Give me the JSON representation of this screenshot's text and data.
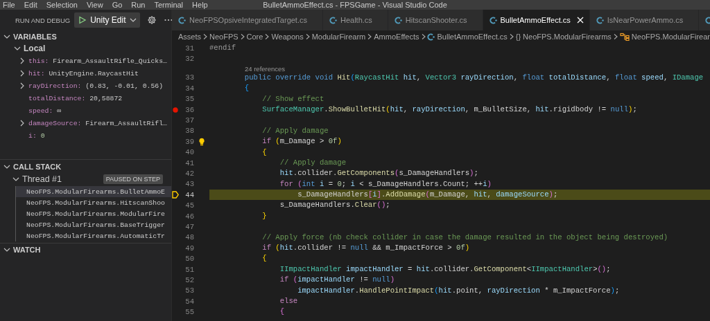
{
  "menu": [
    "File",
    "Edit",
    "Selection",
    "View",
    "Go",
    "Run",
    "Terminal",
    "Help"
  ],
  "window": {
    "title": "BulletAmmoEffect.cs - FPSGame - Visual Studio Code"
  },
  "sidebar": {
    "title": "RUN AND DEBUG",
    "configuration": "Unity Edit",
    "variables": {
      "title": "VARIABLES",
      "expanded": true,
      "scope": {
        "label": "Local",
        "expanded": true
      },
      "items": [
        {
          "name": "this:",
          "value": "Firearm_AssaultRifle_Quicks…",
          "expandable": true,
          "kind": "object"
        },
        {
          "name": "hit:",
          "value": "UnityEngine.RaycastHit",
          "expandable": true,
          "kind": "object"
        },
        {
          "name": "rayDirection:",
          "value": "(0.83, -0.01, 0.56)",
          "expandable": true,
          "kind": "object"
        },
        {
          "name": "totalDistance:",
          "value": "20,58872",
          "expandable": false,
          "kind": "value"
        },
        {
          "name": "speed:",
          "value": "∞",
          "expandable": false,
          "kind": "value"
        },
        {
          "name": "damageSource:",
          "value": "Firearm_AssaultRifl…",
          "expandable": true,
          "kind": "object"
        },
        {
          "name": "i:",
          "value": "0",
          "expandable": false,
          "kind": "number"
        }
      ]
    },
    "call_stack": {
      "title": "CALL STACK",
      "expanded": true,
      "thread": {
        "label": "Thread #1",
        "expanded": true,
        "status": "PAUSED ON STEP"
      },
      "frames": [
        {
          "label": "NeoFPS.ModularFirearms.BulletAmmoE",
          "selected": true
        },
        {
          "label": "NeoFPS.ModularFirearms.HitscanShoo",
          "selected": false
        },
        {
          "label": "NeoFPS.ModularFirearms.ModularFire",
          "selected": false
        },
        {
          "label": "NeoFPS.ModularFirearms.BaseTrigger",
          "selected": false
        },
        {
          "label": "NeoFPS.ModularFirearms.AutomaticTr",
          "selected": false
        }
      ]
    },
    "watch": {
      "title": "WATCH",
      "expanded": true
    }
  },
  "editor": {
    "tabs": [
      {
        "label": "NeoFPSOpsiveIntegratedTarget.cs",
        "selected": false
      },
      {
        "label": "Health.cs",
        "selected": false
      },
      {
        "label": "HitscanShooter.cs",
        "selected": false
      },
      {
        "label": "BulletAmmoEffect.cs",
        "selected": true
      },
      {
        "label": "IsNearPowerAmmo.cs",
        "selected": false
      }
    ],
    "breadcrumbs": [
      {
        "kind": "folder",
        "label": "Assets"
      },
      {
        "kind": "folder",
        "label": "NeoFPS"
      },
      {
        "kind": "folder",
        "label": "Core"
      },
      {
        "kind": "folder",
        "label": "Weapons"
      },
      {
        "kind": "folder",
        "label": "ModularFirearm"
      },
      {
        "kind": "folder",
        "label": "AmmoEffects"
      },
      {
        "kind": "file",
        "label": "BulletAmmoEffect.cs"
      },
      {
        "kind": "namespace",
        "symbol": "{}",
        "label": "NeoFPS.ModularFirearms"
      },
      {
        "kind": "class",
        "label": "NeoFPS.ModularFirear"
      }
    ],
    "lines": [
      {
        "number": "31",
        "breakpoint": false,
        "current": false,
        "lightbulb": false,
        "segments": [
          {
            "kind": "preprocessor",
            "text": "#endif"
          }
        ]
      },
      {
        "number": "32",
        "breakpoint": false,
        "current": false,
        "lightbulb": false
      },
      {
        "number": "33",
        "breakpoint": false,
        "current": false,
        "lightbulb": false,
        "codelens": "24 references",
        "segments": [
          {
            "kind": "keyword",
            "text": "        public override void "
          },
          {
            "kind": "method",
            "text": "Hit"
          },
          {
            "kind": "bracket3",
            "text": "("
          },
          {
            "kind": "type",
            "text": "RaycastHit "
          },
          {
            "kind": "variable",
            "text": "hit"
          },
          {
            "kind": "plain",
            "text": ", "
          },
          {
            "kind": "type",
            "text": "Vector3 "
          },
          {
            "kind": "variable",
            "text": "rayDirection"
          },
          {
            "kind": "plain",
            "text": ", "
          },
          {
            "kind": "keyword",
            "text": "float "
          },
          {
            "kind": "variable",
            "text": "totalDistance"
          },
          {
            "kind": "plain",
            "text": ", "
          },
          {
            "kind": "keyword",
            "text": "float "
          },
          {
            "kind": "variable",
            "text": "speed"
          },
          {
            "kind": "plain",
            "text": ", "
          },
          {
            "kind": "type",
            "text": "IDamage"
          }
        ]
      },
      {
        "number": "34",
        "breakpoint": false,
        "current": false,
        "lightbulb": false,
        "segments": [
          {
            "kind": "bracket3",
            "text": "        {"
          }
        ]
      },
      {
        "number": "35",
        "breakpoint": false,
        "current": false,
        "lightbulb": false,
        "segments": [
          {
            "kind": "comment",
            "text": "            // Show effect"
          }
        ]
      },
      {
        "number": "36",
        "breakpoint": true,
        "current": false,
        "lightbulb": false,
        "segments": [
          {
            "kind": "type",
            "text": "            SurfaceManager"
          },
          {
            "kind": "plain",
            "text": "."
          },
          {
            "kind": "method",
            "text": "ShowBulletHit"
          },
          {
            "kind": "bracket1",
            "text": "("
          },
          {
            "kind": "variable",
            "text": "hit"
          },
          {
            "kind": "plain",
            "text": ", "
          },
          {
            "kind": "variable",
            "text": "rayDirection"
          },
          {
            "kind": "plain",
            "text": ", m_BulletSize, "
          },
          {
            "kind": "variable",
            "text": "hit"
          },
          {
            "kind": "plain",
            "text": ".rigidbody != "
          },
          {
            "kind": "keyword",
            "text": "null"
          },
          {
            "kind": "bracket1",
            "text": ")"
          },
          {
            "kind": "plain",
            "text": ";"
          }
        ]
      },
      {
        "number": "37",
        "breakpoint": false,
        "current": false,
        "lightbulb": false
      },
      {
        "number": "38",
        "breakpoint": false,
        "current": false,
        "lightbulb": false,
        "segments": [
          {
            "kind": "comment",
            "text": "            // Apply damage"
          }
        ]
      },
      {
        "number": "39",
        "breakpoint": false,
        "current": false,
        "lightbulb": true,
        "segments": [
          {
            "kind": "control",
            "text": "            if "
          },
          {
            "kind": "bracket1",
            "text": "("
          },
          {
            "kind": "plain",
            "text": "m_Damage > "
          },
          {
            "kind": "number",
            "text": "0f"
          },
          {
            "kind": "bracket1",
            "text": ")"
          }
        ]
      },
      {
        "number": "40",
        "breakpoint": false,
        "current": false,
        "lightbulb": false,
        "segments": [
          {
            "kind": "bracket1",
            "text": "            {"
          }
        ]
      },
      {
        "number": "41",
        "breakpoint": false,
        "current": false,
        "lightbulb": false,
        "segments": [
          {
            "kind": "comment",
            "text": "                // Apply damage"
          }
        ]
      },
      {
        "number": "42",
        "breakpoint": false,
        "current": false,
        "lightbulb": false,
        "segments": [
          {
            "kind": "variable",
            "text": "                hit"
          },
          {
            "kind": "plain",
            "text": ".collider."
          },
          {
            "kind": "method",
            "text": "GetComponents"
          },
          {
            "kind": "bracket2",
            "text": "("
          },
          {
            "kind": "plain",
            "text": "s_DamageHandlers"
          },
          {
            "kind": "bracket2",
            "text": ")"
          },
          {
            "kind": "plain",
            "text": ";"
          }
        ]
      },
      {
        "number": "43",
        "breakpoint": false,
        "current": false,
        "lightbulb": false,
        "segments": [
          {
            "kind": "control",
            "text": "                for "
          },
          {
            "kind": "bracket2",
            "text": "("
          },
          {
            "kind": "keyword",
            "text": "int "
          },
          {
            "kind": "variable",
            "text": "i"
          },
          {
            "kind": "plain",
            "text": " = "
          },
          {
            "kind": "number",
            "text": "0"
          },
          {
            "kind": "plain",
            "text": "; "
          },
          {
            "kind": "variable",
            "text": "i"
          },
          {
            "kind": "plain",
            "text": " < s_DamageHandlers.Count; ++"
          },
          {
            "kind": "variable",
            "text": "i"
          },
          {
            "kind": "bracket2",
            "text": ")"
          }
        ]
      },
      {
        "number": "44",
        "breakpoint": false,
        "current": true,
        "lightbulb": false,
        "segments": [
          {
            "kind": "plain",
            "text": "                    s_DamageHandlers"
          },
          {
            "kind": "bracket2",
            "text": "["
          },
          {
            "kind": "variable",
            "text": "i"
          },
          {
            "kind": "bracket2",
            "text": "]"
          },
          {
            "kind": "plain",
            "text": "."
          },
          {
            "kind": "method",
            "text": "AddDamage"
          },
          {
            "kind": "bracket2",
            "text": "("
          },
          {
            "kind": "plain",
            "text": "m_Damage, "
          },
          {
            "kind": "variable",
            "text": "hit"
          },
          {
            "kind": "plain",
            "text": ", "
          },
          {
            "kind": "variable",
            "text": "damageSource"
          },
          {
            "kind": "bracket2",
            "text": ")"
          },
          {
            "kind": "plain",
            "text": ";"
          }
        ]
      },
      {
        "number": "45",
        "breakpoint": false,
        "current": false,
        "lightbulb": false,
        "segments": [
          {
            "kind": "plain",
            "text": "                s_DamageHandlers."
          },
          {
            "kind": "method",
            "text": "Clear"
          },
          {
            "kind": "bracket2",
            "text": "()"
          },
          {
            "kind": "plain",
            "text": ";"
          }
        ]
      },
      {
        "number": "46",
        "breakpoint": false,
        "current": false,
        "lightbulb": false,
        "segments": [
          {
            "kind": "bracket1",
            "text": "            }"
          }
        ]
      },
      {
        "number": "47",
        "breakpoint": false,
        "current": false,
        "lightbulb": false
      },
      {
        "number": "48",
        "breakpoint": false,
        "current": false,
        "lightbulb": false,
        "segments": [
          {
            "kind": "comment",
            "text": "            // Apply force (nb check collider in case the damage resulted in the object being destroyed)"
          }
        ]
      },
      {
        "number": "49",
        "breakpoint": false,
        "current": false,
        "lightbulb": false,
        "segments": [
          {
            "kind": "control",
            "text": "            if "
          },
          {
            "kind": "bracket1",
            "text": "("
          },
          {
            "kind": "variable",
            "text": "hit"
          },
          {
            "kind": "plain",
            "text": ".collider != "
          },
          {
            "kind": "keyword",
            "text": "null"
          },
          {
            "kind": "plain",
            "text": " && m_ImpactForce > "
          },
          {
            "kind": "number",
            "text": "0f"
          },
          {
            "kind": "bracket1",
            "text": ")"
          }
        ]
      },
      {
        "number": "50",
        "breakpoint": false,
        "current": false,
        "lightbulb": false,
        "segments": [
          {
            "kind": "bracket1",
            "text": "            {"
          }
        ]
      },
      {
        "number": "51",
        "breakpoint": false,
        "current": false,
        "lightbulb": false,
        "segments": [
          {
            "kind": "type",
            "text": "                IImpactHandler "
          },
          {
            "kind": "variable",
            "text": "impactHandler"
          },
          {
            "kind": "plain",
            "text": " = "
          },
          {
            "kind": "variable",
            "text": "hit"
          },
          {
            "kind": "plain",
            "text": ".collider."
          },
          {
            "kind": "method",
            "text": "GetComponent"
          },
          {
            "kind": "plain",
            "text": "<"
          },
          {
            "kind": "type",
            "text": "IImpactHandler"
          },
          {
            "kind": "plain",
            "text": ">"
          },
          {
            "kind": "bracket2",
            "text": "()"
          },
          {
            "kind": "plain",
            "text": ";"
          }
        ]
      },
      {
        "number": "52",
        "breakpoint": false,
        "current": false,
        "lightbulb": false,
        "segments": [
          {
            "kind": "control",
            "text": "                if "
          },
          {
            "kind": "bracket2",
            "text": "("
          },
          {
            "kind": "variable",
            "text": "impactHandler"
          },
          {
            "kind": "plain",
            "text": " != "
          },
          {
            "kind": "keyword",
            "text": "null"
          },
          {
            "kind": "bracket2",
            "text": ")"
          }
        ]
      },
      {
        "number": "53",
        "breakpoint": false,
        "current": false,
        "lightbulb": false,
        "segments": [
          {
            "kind": "variable",
            "text": "                    impactHandler"
          },
          {
            "kind": "plain",
            "text": "."
          },
          {
            "kind": "method",
            "text": "HandlePointImpact"
          },
          {
            "kind": "bracket3",
            "text": "("
          },
          {
            "kind": "variable",
            "text": "hit"
          },
          {
            "kind": "plain",
            "text": ".point, "
          },
          {
            "kind": "variable",
            "text": "rayDirection"
          },
          {
            "kind": "plain",
            "text": " * m_ImpactForce"
          },
          {
            "kind": "bracket3",
            "text": ")"
          },
          {
            "kind": "plain",
            "text": ";"
          }
        ]
      },
      {
        "number": "54",
        "breakpoint": false,
        "current": false,
        "lightbulb": false,
        "segments": [
          {
            "kind": "control",
            "text": "                else"
          }
        ]
      },
      {
        "number": "55",
        "breakpoint": false,
        "current": false,
        "lightbulb": false,
        "segments": [
          {
            "kind": "bracket2",
            "text": "                {"
          }
        ]
      }
    ]
  }
}
